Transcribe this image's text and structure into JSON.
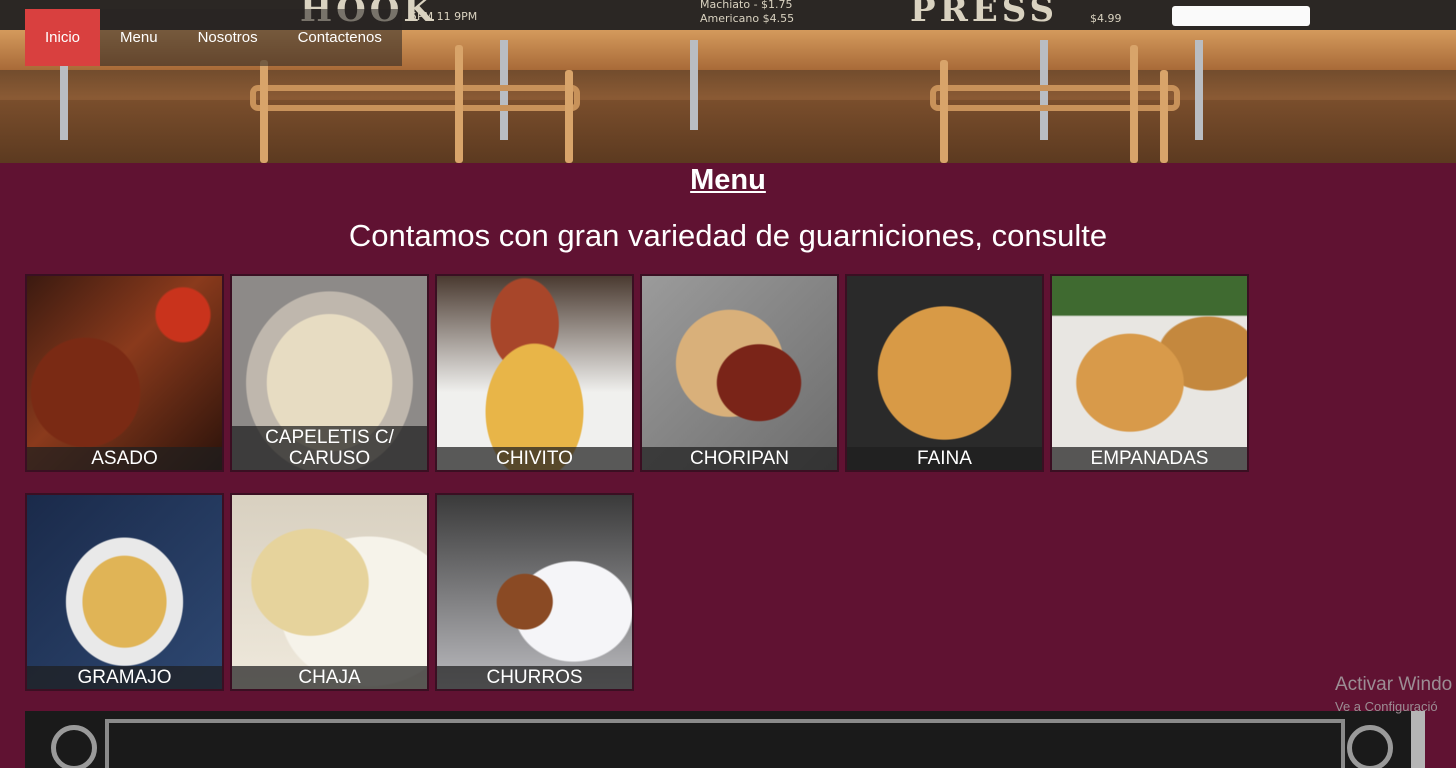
{
  "nav": {
    "items": [
      {
        "label": "Inicio",
        "active": true
      },
      {
        "label": "Menu",
        "active": false
      },
      {
        "label": "Nosotros",
        "active": false
      },
      {
        "label": "Contactenos",
        "active": false
      }
    ]
  },
  "hero": {
    "board_left": "HOOK",
    "board_right": "PRESS",
    "board_small_1": "5PM   11 9PM",
    "board_small_2": "Machiato  -  $1.75",
    "board_small_3": "Americano  $4.55",
    "board_small_4": "$4.99"
  },
  "main": {
    "title": "Menu",
    "subtitle": "Contamos con gran variedad de guarniciones, consulte"
  },
  "menu_items": [
    {
      "label": "ASADO"
    },
    {
      "label": "CAPELETIS C/ CARUSO"
    },
    {
      "label": "CHIVITO"
    },
    {
      "label": "CHORIPAN"
    },
    {
      "label": "FAINA"
    },
    {
      "label": "EMPANADAS"
    },
    {
      "label": "GRAMAJO"
    },
    {
      "label": "CHAJA"
    },
    {
      "label": "CHURROS"
    }
  ],
  "watermark": {
    "line1": "Activar Windo",
    "line2": "Ve a Configuració"
  },
  "colors": {
    "background": "#601232",
    "nav_active": "#d9403f"
  }
}
